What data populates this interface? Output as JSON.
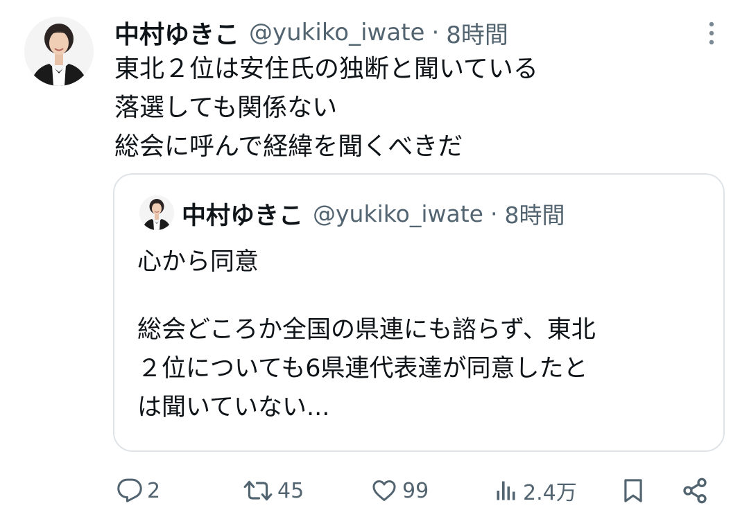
{
  "tweet": {
    "author_name": "中村ゆきこ",
    "handle": "@yukiko_iwate",
    "separator": "·",
    "time": "8時間",
    "lines": [
      "東北２位は安住氏の独断と聞いている",
      "落選しても関係ない",
      "総会に呼んで経緯を聞くべきだ"
    ]
  },
  "quoted": {
    "author_name": "中村ゆきこ",
    "handle": "@yukiko_iwate",
    "separator": "·",
    "time": "8時間",
    "lines": [
      "心から同意",
      "",
      "総会どころか全国の県連にも諮らず、東北",
      "２位についても6県連代表達が同意したと",
      "は聞いていない..."
    ]
  },
  "actions": {
    "reply_count": "2",
    "retweet_count": "45",
    "like_count": "99",
    "view_count": "2.4万"
  },
  "colors": {
    "text": "#0f1419",
    "secondary": "#536471",
    "border": "#dfe3e7"
  }
}
